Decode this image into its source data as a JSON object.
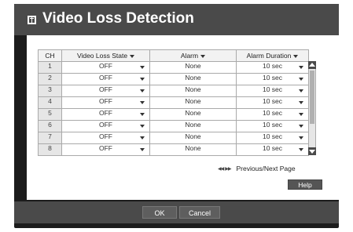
{
  "window": {
    "title": "Video Loss Detection",
    "title_icon": "menu-grid-icon"
  },
  "table": {
    "headers": {
      "ch": "CH",
      "state": "Video Loss State",
      "alarm": "Alarm",
      "duration": "Alarm Duration"
    },
    "rows": [
      {
        "ch": "1",
        "state": "OFF",
        "alarm": "None",
        "duration": "10 sec"
      },
      {
        "ch": "2",
        "state": "OFF",
        "alarm": "None",
        "duration": "10 sec"
      },
      {
        "ch": "3",
        "state": "OFF",
        "alarm": "None",
        "duration": "10 sec"
      },
      {
        "ch": "4",
        "state": "OFF",
        "alarm": "None",
        "duration": "10 sec"
      },
      {
        "ch": "5",
        "state": "OFF",
        "alarm": "None",
        "duration": "10 sec"
      },
      {
        "ch": "6",
        "state": "OFF",
        "alarm": "None",
        "duration": "10 sec"
      },
      {
        "ch": "7",
        "state": "OFF",
        "alarm": "None",
        "duration": "10 sec"
      },
      {
        "ch": "8",
        "state": "OFF",
        "alarm": "None",
        "duration": "10 sec"
      }
    ]
  },
  "pager": {
    "prev_icon": "◀◀",
    "next_icon": "▶▶",
    "label": "Previous/Next Page"
  },
  "buttons": {
    "help": "Help",
    "ok": "OK",
    "cancel": "Cancel"
  }
}
